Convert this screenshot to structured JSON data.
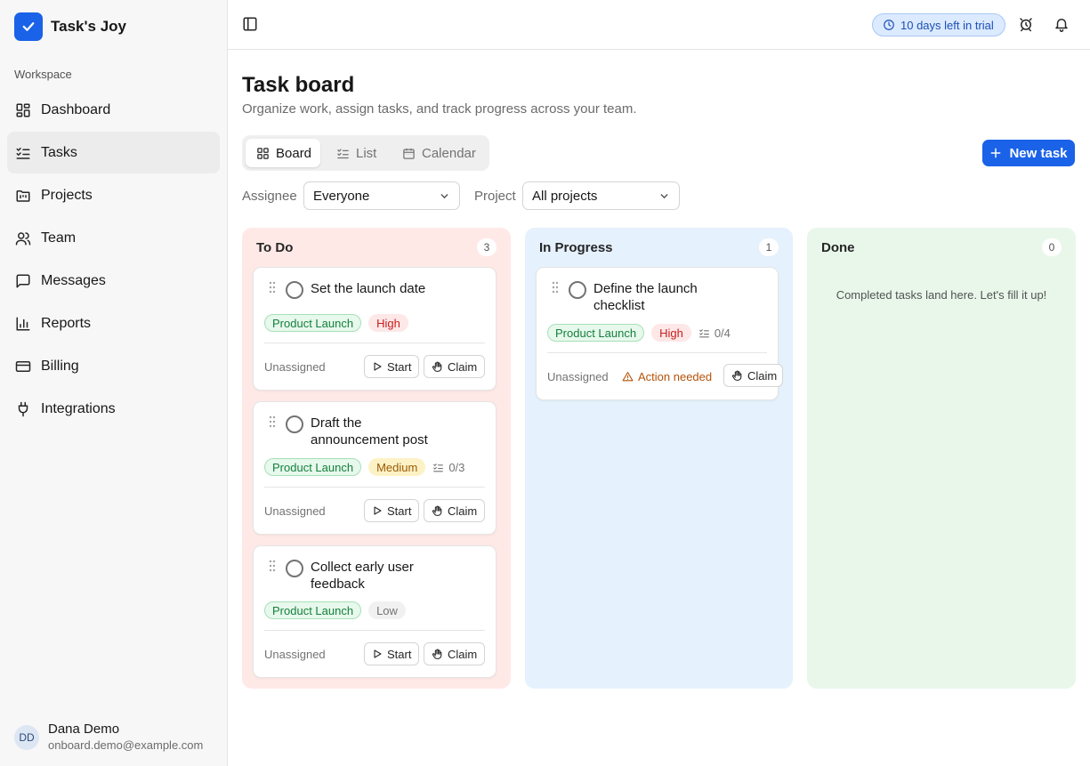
{
  "app": {
    "name": "Task's Joy"
  },
  "sidebar": {
    "section_label": "Workspace",
    "items": [
      {
        "label": "Dashboard",
        "icon": "layout-grid-icon"
      },
      {
        "label": "Tasks",
        "icon": "list-checks-icon",
        "active": true
      },
      {
        "label": "Projects",
        "icon": "folder-kanban-icon"
      },
      {
        "label": "Team",
        "icon": "users-icon"
      },
      {
        "label": "Messages",
        "icon": "message-square-icon"
      },
      {
        "label": "Reports",
        "icon": "bar-chart-icon"
      },
      {
        "label": "Billing",
        "icon": "credit-card-icon"
      },
      {
        "label": "Integrations",
        "icon": "plug-icon"
      }
    ],
    "user": {
      "initials": "DD",
      "name": "Dana Demo",
      "email": "onboard.demo@example.com"
    }
  },
  "topbar": {
    "trial_text": "10 days left in trial"
  },
  "page": {
    "title": "Task board",
    "subtitle": "Organize work, assign tasks, and track progress across your team."
  },
  "view_tabs": {
    "board": "Board",
    "list": "List",
    "calendar": "Calendar",
    "active": "board"
  },
  "new_task_label": "New task",
  "filters": {
    "assignee_label": "Assignee",
    "assignee_value": "Everyone",
    "project_label": "Project",
    "project_value": "All projects"
  },
  "columns": {
    "todo": {
      "title": "To Do",
      "count": "3",
      "cards": [
        {
          "title": "Set the launch date",
          "project": "Product Launch",
          "priority": "High",
          "subtasks": "",
          "assignee": "Unassigned",
          "start": "Start",
          "claim": "Claim"
        },
        {
          "title": "Draft the announcement post",
          "project": "Product Launch",
          "priority": "Medium",
          "subtasks": "0/3",
          "assignee": "Unassigned",
          "start": "Start",
          "claim": "Claim"
        },
        {
          "title": "Collect early user feedback",
          "project": "Product Launch",
          "priority": "Low",
          "subtasks": "",
          "assignee": "Unassigned",
          "start": "Start",
          "claim": "Claim"
        }
      ]
    },
    "in_progress": {
      "title": "In Progress",
      "count": "1",
      "cards": [
        {
          "title": "Define the launch checklist",
          "project": "Product Launch",
          "priority": "High",
          "subtasks": "0/4",
          "assignee": "Unassigned",
          "status": "Action needed",
          "claim": "Claim"
        }
      ]
    },
    "done": {
      "title": "Done",
      "count": "0",
      "empty_text": "Completed tasks land here. Let's fill it up!"
    }
  },
  "colors": {
    "accent": "#1a62e8",
    "todo_bg": "#ffe9e6",
    "progress_bg": "#e5f1fd",
    "done_bg": "#e8f7ea"
  }
}
